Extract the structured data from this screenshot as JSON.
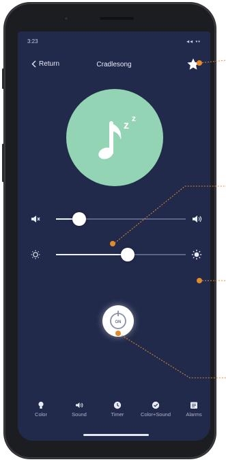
{
  "status_bar": {
    "time": "3:23",
    "icons": "◂◂ ▪▪"
  },
  "nav": {
    "return_label": "Return",
    "title": "Cradlesong"
  },
  "icons": {
    "favorite": "star-icon",
    "hero": "music-note-sleep-icon",
    "volume_min": "speaker-mute-icon",
    "volume_max": "speaker-loud-icon",
    "brightness_min": "brightness-low-icon",
    "brightness_max": "brightness-high-icon",
    "power": "power-icon"
  },
  "controls": {
    "volume_level": 0.18,
    "brightness_level": 0.55,
    "power_label": "ON"
  },
  "tabs": [
    {
      "label": "Color",
      "icon": "bulb-icon"
    },
    {
      "label": "Sound",
      "icon": "speaker-icon"
    },
    {
      "label": "Timer",
      "icon": "clock-icon"
    },
    {
      "label": "Color+Sound",
      "icon": "color-sound-icon"
    },
    {
      "label": "Alarms",
      "icon": "alarm-icon"
    }
  ],
  "colors": {
    "screen_bg": "#222a4b",
    "hero_circle": "#92d4b4",
    "callout": "#e08b2c"
  }
}
